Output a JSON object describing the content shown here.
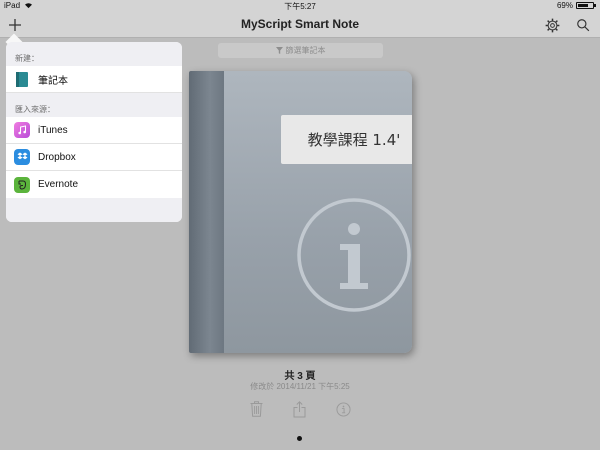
{
  "status_bar": {
    "device": "iPad",
    "time": "下午5:27",
    "battery": "69%",
    "battery_level": 0.69
  },
  "nav": {
    "title": "MyScript Smart Note",
    "left_icon": "plus-icon",
    "right_icons": [
      "gear-icon",
      "search-icon"
    ]
  },
  "filter": {
    "label": "篩選筆記本",
    "icon": "filter-icon"
  },
  "notebook": {
    "title": "教學課程 1.4'",
    "emblem_icon": "info-icon",
    "colors": {
      "cover": "#a3abb3",
      "spine": "#6f7983"
    }
  },
  "notebook_meta": {
    "page_count": "共 3 頁",
    "modified": "修改於 2014/11/21 下午5:25"
  },
  "actions": {
    "icons": [
      "trash-icon",
      "share-icon",
      "info-icon"
    ]
  },
  "popover": {
    "new_section": "新建：",
    "new_items": [
      {
        "label": "筆記本",
        "icon": "notebook-icon",
        "color": "#2a8a93"
      }
    ],
    "import_section": "匯入來源：",
    "import_items": [
      {
        "label": "iTunes",
        "icon": "itunes-icon",
        "color": "#d04ee0"
      },
      {
        "label": "Dropbox",
        "icon": "dropbox-icon",
        "color": "#2b8de0"
      },
      {
        "label": "Evernote",
        "icon": "evernote-icon",
        "color": "#5bb43c"
      }
    ]
  }
}
